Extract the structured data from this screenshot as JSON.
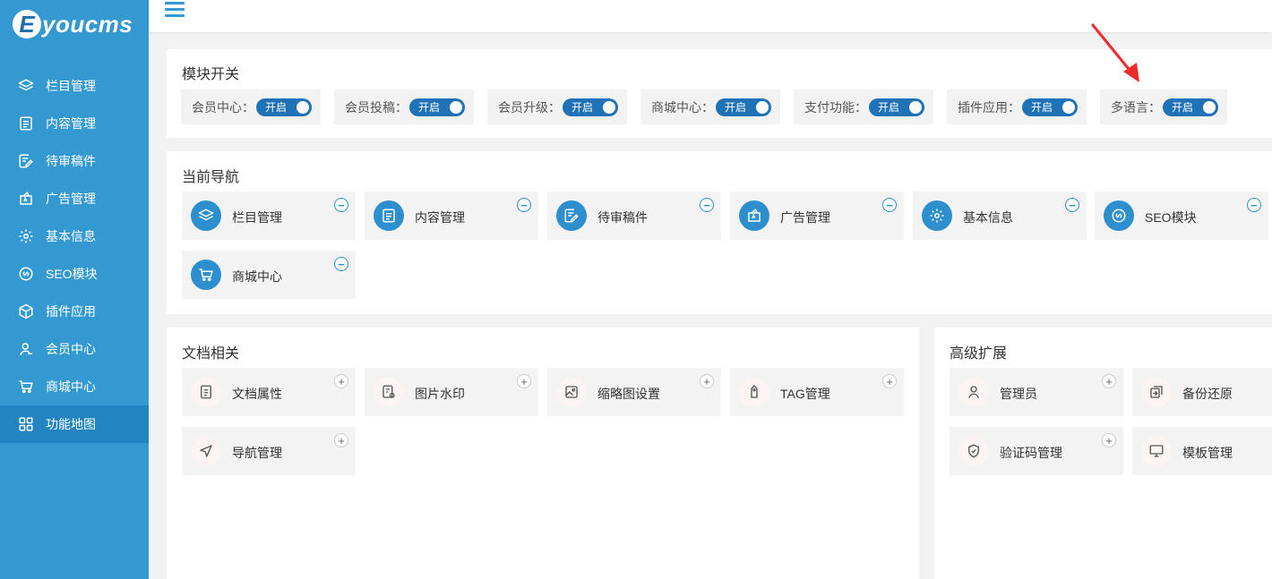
{
  "app": {
    "logo_letter": "E",
    "logo_text": "youcms"
  },
  "sidebar": {
    "items": [
      {
        "label": "栏目管理",
        "icon": "layers-icon"
      },
      {
        "label": "内容管理",
        "icon": "document-icon"
      },
      {
        "label": "待审稿件",
        "icon": "edit-doc-icon"
      },
      {
        "label": "广告管理",
        "icon": "ad-icon"
      },
      {
        "label": "基本信息",
        "icon": "gear-icon"
      },
      {
        "label": "SEO模块",
        "icon": "link-icon"
      },
      {
        "label": "插件应用",
        "icon": "cube-icon"
      },
      {
        "label": "会员中心",
        "icon": "user-icon"
      },
      {
        "label": "商城中心",
        "icon": "cart-icon"
      },
      {
        "label": "功能地图",
        "icon": "grid-icon"
      }
    ],
    "active_index": 9
  },
  "modules": {
    "title": "模块开关",
    "switches": [
      {
        "label": "会员中心：",
        "state": "开启"
      },
      {
        "label": "会员投稿：",
        "state": "开启"
      },
      {
        "label": "会员升级：",
        "state": "开启"
      },
      {
        "label": "商城中心：",
        "state": "开启"
      },
      {
        "label": "支付功能：",
        "state": "开启"
      },
      {
        "label": "插件应用：",
        "state": "开启"
      },
      {
        "label": "多语言：",
        "state": "开启"
      }
    ]
  },
  "current_nav": {
    "title": "当前导航",
    "items": [
      {
        "label": "栏目管理",
        "icon": "layers-icon"
      },
      {
        "label": "内容管理",
        "icon": "document-icon"
      },
      {
        "label": "待审稿件",
        "icon": "edit-doc-icon"
      },
      {
        "label": "广告管理",
        "icon": "ad-icon"
      },
      {
        "label": "基本信息",
        "icon": "gear-icon"
      },
      {
        "label": "SEO模块",
        "icon": "link-icon"
      },
      {
        "label": "商城中心",
        "icon": "cart-icon"
      }
    ]
  },
  "docs": {
    "title": "文档相关",
    "items": [
      {
        "label": "文档属性",
        "icon": "document-icon"
      },
      {
        "label": "图片水印",
        "icon": "watermark-icon"
      },
      {
        "label": "缩略图设置",
        "icon": "image-icon"
      },
      {
        "label": "TAG管理",
        "icon": "tag-icon"
      },
      {
        "label": "导航管理",
        "icon": "navigation-icon"
      }
    ]
  },
  "advanced": {
    "title": "高级扩展",
    "items": [
      {
        "label": "管理员",
        "icon": "user-icon"
      },
      {
        "label": "备份还原",
        "icon": "backup-icon"
      },
      {
        "label": "验证码管理",
        "icon": "shield-icon"
      },
      {
        "label": "模板管理",
        "icon": "monitor-icon"
      }
    ]
  },
  "colors": {
    "sidebar": "#3499d1",
    "active": "#2284c0",
    "accent": "#2d8fce",
    "toggle": "#1e72b5",
    "arrow": "#f02b2b"
  },
  "symbols": {
    "minus": "−",
    "plus": "+"
  }
}
